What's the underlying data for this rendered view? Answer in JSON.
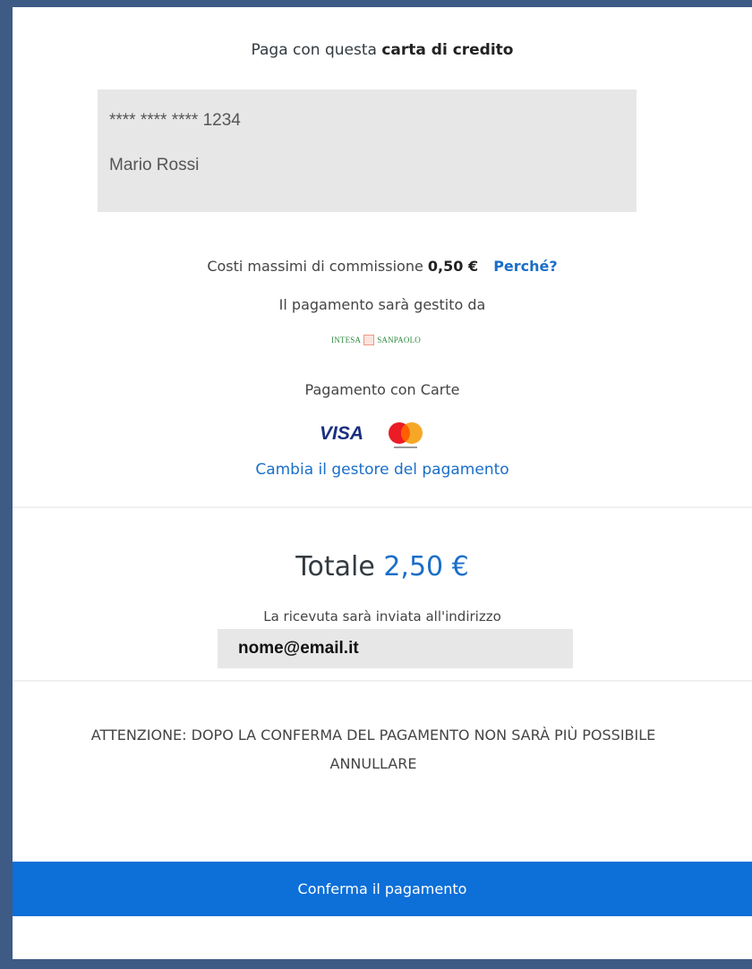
{
  "header": {
    "prefix": "Paga con questa",
    "emphasis": "carta di credito"
  },
  "card": {
    "masked_number": "**** **** **** 1234",
    "holder": "Mario Rossi"
  },
  "fees": {
    "label": "Costi massimi di commissione",
    "amount": "0,50 €",
    "why_link": "Perché?"
  },
  "psp": {
    "handled_by": "Il pagamento sarà gestito da",
    "logo_left": "INTESA",
    "logo_right": "SANPAOLO",
    "logo_icon": "intesa-sanpaolo-logo-icon",
    "logo_color": "#2e8b3e"
  },
  "method": {
    "label": "Pagamento con Carte",
    "brands": [
      "VISA",
      "Mastercard"
    ],
    "change_link": "Cambia il gestore del pagamento"
  },
  "summary": {
    "total_label": "Totale",
    "total_amount": "2,50 €",
    "receipt_text": "La ricevuta sarà inviata all'indirizzo",
    "email": "nome@email.it"
  },
  "warning": {
    "line1": "ATTENZIONE: DOPO LA CONFERMA DEL PAGAMENTO NON SARÀ PIÙ POSSIBILE",
    "line2": "ANNULLARE"
  },
  "actions": {
    "confirm_label": "Conferma il pagamento"
  },
  "colors": {
    "accent": "#0d6fd8",
    "link": "#1a6ec8",
    "frame": "#3d5b85",
    "field_bg": "#e7e7e7"
  }
}
